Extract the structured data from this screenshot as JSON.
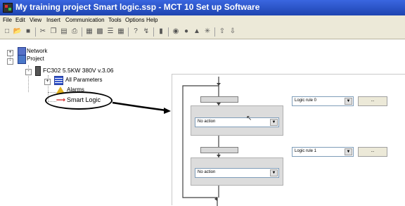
{
  "window": {
    "title": "My training project Smart logic.ssp - MCT 10 Set up Software"
  },
  "menu": {
    "items": [
      "File",
      "Edit",
      "View",
      "Insert",
      "Communication",
      "Tools",
      "Options",
      "Help"
    ]
  },
  "tree": {
    "network": "Network",
    "project": "Project",
    "drive": "FC302 5.5KW 380V v.3.06",
    "all_parameters": "All Parameters",
    "alarms": "Alarms",
    "smart_logic": "Smart Logic"
  },
  "diagram": {
    "action_1": "No action",
    "action_2": "No action",
    "logic_rule_1": "Logic rule 0",
    "logic_rule_2": "Logic rule 1",
    "button_1": "...",
    "button_2": "..."
  }
}
